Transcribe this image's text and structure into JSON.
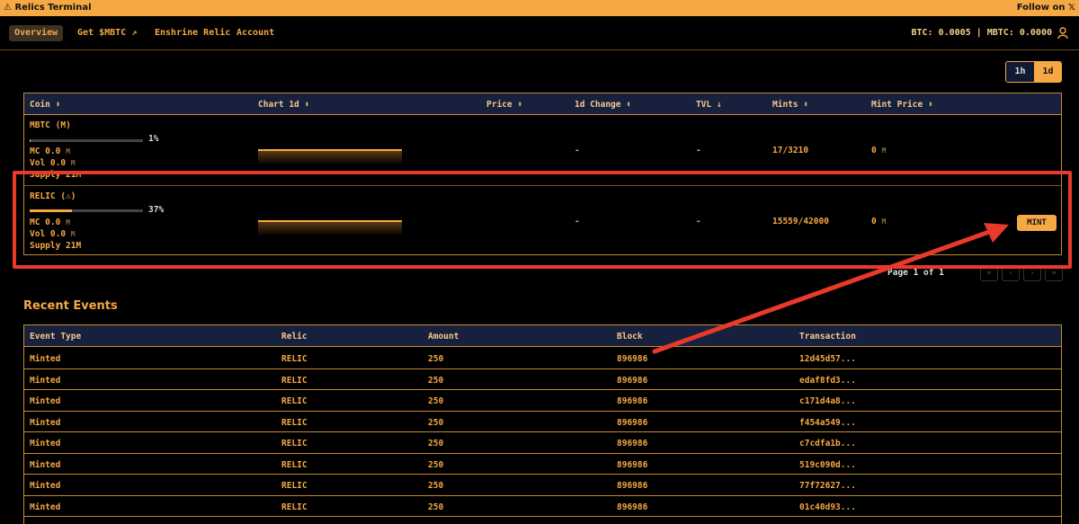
{
  "topbar": {
    "title": "⚠ Relics Terminal",
    "follow": "Follow on 𝕏"
  },
  "nav": {
    "items": [
      "Overview",
      "Get $MBTC",
      "Enshrine Relic",
      "Account"
    ],
    "balance": "BTC: 0.0005 | MBTC: 0.0000"
  },
  "toggle": {
    "opt1": "1h",
    "opt2": "1d"
  },
  "coins": {
    "headers": [
      "Coin",
      "Chart 1d",
      "Price",
      "1d Change",
      "TVL",
      "Mints",
      "Mint Price"
    ],
    "rows": [
      {
        "name": "MBTC",
        "symbol": "M",
        "progress_label": "1%",
        "progress": 0.01,
        "mc_label": "MC 0.0",
        "vol_label": "Vol 0.0",
        "supply": "Supply 21M",
        "unit": "M",
        "change": "-",
        "tvl": "-",
        "mints": "17/3210",
        "mint_price": "0",
        "mint_unit": "M"
      },
      {
        "name": "RELIC",
        "symbol": "⚠",
        "progress_label": "37%",
        "progress": 0.37,
        "mc_label": "MC 0.0",
        "vol_label": "Vol 0.0",
        "supply": "Supply 21M",
        "unit": "M",
        "change": "-",
        "tvl": "-",
        "mints": "15559/42000",
        "mint_price": "0",
        "mint_unit": "M",
        "action": "MINT"
      }
    ]
  },
  "pager": {
    "label": "Page 1 of 1",
    "first": "«",
    "prev": "‹",
    "next": "›",
    "last": "»"
  },
  "events": {
    "title": "Recent Events",
    "headers": [
      "Event Type",
      "Relic",
      "Amount",
      "Block",
      "Transaction"
    ],
    "rows": [
      [
        "Minted",
        "RELIC",
        "250",
        "896986",
        "12d45d57..."
      ],
      [
        "Minted",
        "RELIC",
        "250",
        "896986",
        "edaf8fd3..."
      ],
      [
        "Minted",
        "RELIC",
        "250",
        "896986",
        "c171d4a8..."
      ],
      [
        "Minted",
        "RELIC",
        "250",
        "896986",
        "f454a549..."
      ],
      [
        "Minted",
        "RELIC",
        "250",
        "896986",
        "c7cdfa1b..."
      ],
      [
        "Minted",
        "RELIC",
        "250",
        "896986",
        "519c090d..."
      ],
      [
        "Minted",
        "RELIC",
        "250",
        "896986",
        "77f72627..."
      ],
      [
        "Minted",
        "RELIC",
        "250",
        "896986",
        "01c40d93..."
      ]
    ]
  },
  "colors": {
    "accent": "#f5a843",
    "header_bg": "#17213e",
    "annotation": "#e8392a"
  }
}
